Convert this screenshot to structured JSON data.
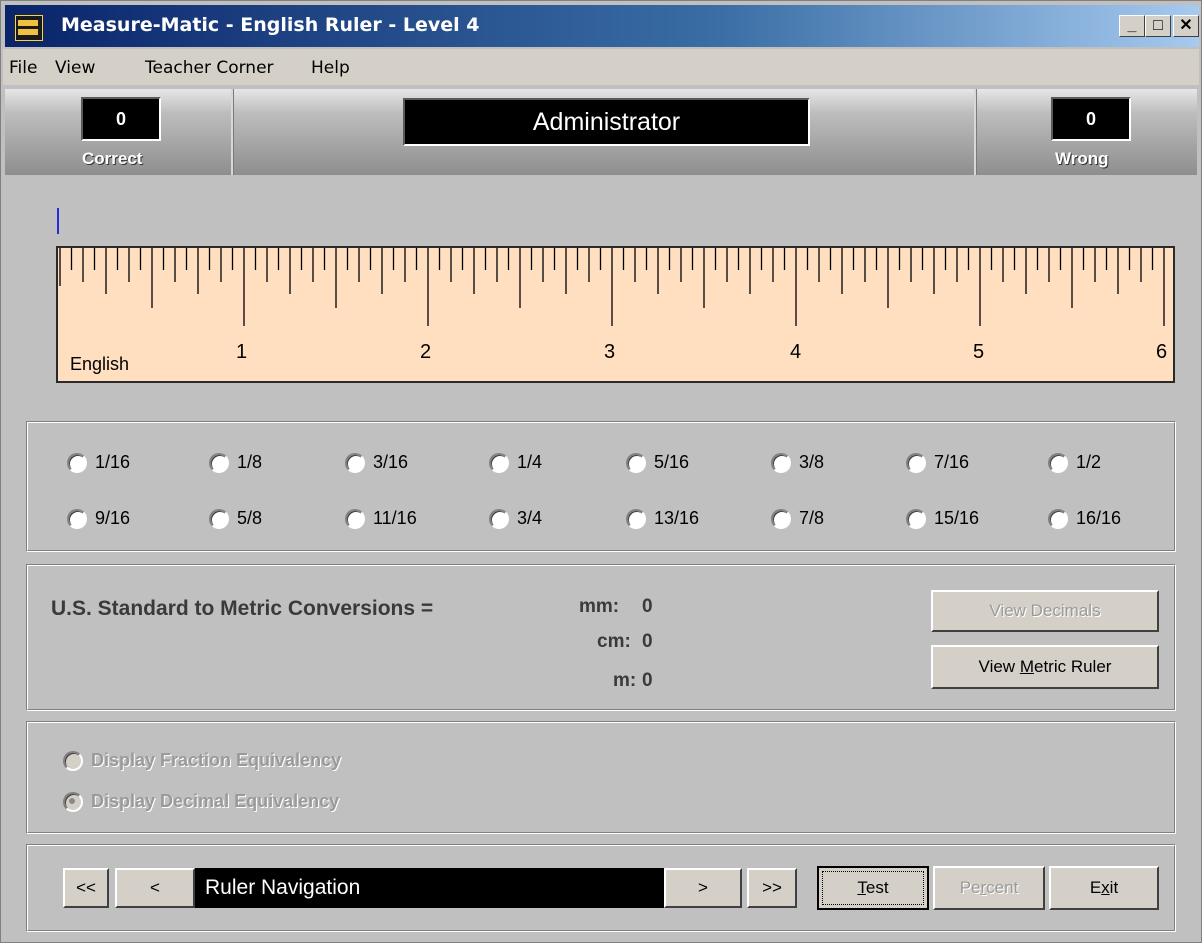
{
  "window": {
    "title": "Measure-Matic - English Ruler - Level 4",
    "controls": {
      "minimize": "_",
      "maximize": "□",
      "close": "✕"
    }
  },
  "menu": [
    "File",
    "View",
    "Teacher Corner",
    "Help"
  ],
  "header": {
    "correct_count": "0",
    "correct_label": "Correct",
    "user_name": "Administrator",
    "wrong_count": "0",
    "wrong_label": "Wrong"
  },
  "ruler": {
    "label": "English",
    "numbers": [
      "1",
      "2",
      "3",
      "4",
      "5",
      "6"
    ],
    "subdivisions_per_inch": 16,
    "inches": 6
  },
  "fractions": {
    "row1": [
      "1/16",
      "1/8",
      "3/16",
      "1/4",
      "5/16",
      "3/8",
      "7/16",
      "1/2"
    ],
    "row2": [
      "9/16",
      "5/8",
      "11/16",
      "3/4",
      "13/16",
      "7/8",
      "15/16",
      "16/16"
    ]
  },
  "conversions": {
    "title": "U.S. Standard to Metric Conversions =",
    "mm_label": "mm:",
    "mm_value": "0",
    "cm_label": "cm:",
    "cm_value": "0",
    "m_label": "m:",
    "m_value": "0",
    "view_decimals": "View Decimals",
    "view_metric_ruler_pre": "View ",
    "view_metric_ruler_u": "M",
    "view_metric_ruler_post": "etric Ruler"
  },
  "equivalency": {
    "fraction": "Display Fraction Equivalency",
    "decimal": "Display Decimal Equivalency",
    "selected": "decimal"
  },
  "navigation": {
    "first": "<<",
    "prev": "<",
    "display": "Ruler Navigation",
    "next": ">",
    "last": ">>",
    "test_u": "T",
    "test_rest": "est",
    "percent_pre": "Pe",
    "percent_u": "r",
    "percent_post": "cent",
    "exit_pre": "E",
    "exit_u": "x",
    "exit_post": "it"
  }
}
